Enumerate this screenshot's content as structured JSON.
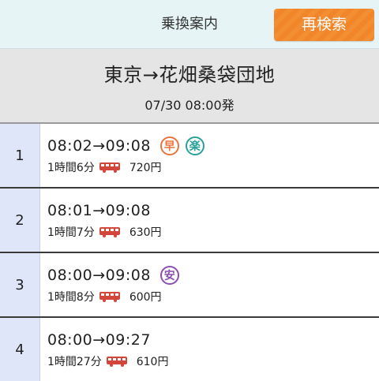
{
  "header": {
    "title": "乗換案内",
    "research_label": "再検索"
  },
  "route": {
    "name": "東京→花畑桑袋団地",
    "datetime": "07/30  08:00発"
  },
  "results": [
    {
      "index": "1",
      "time": "08:02→09:08",
      "duration": "1時間6分",
      "fare": "720円",
      "badges": [
        {
          "label": "早",
          "type": "fast"
        },
        {
          "label": "楽",
          "type": "easy"
        }
      ]
    },
    {
      "index": "2",
      "time": "08:01→09:08",
      "duration": "1時間7分",
      "fare": "630円",
      "badges": []
    },
    {
      "index": "3",
      "time": "08:00→09:08",
      "duration": "1時間8分",
      "fare": "600円",
      "badges": [
        {
          "label": "安",
          "type": "cheap"
        }
      ]
    },
    {
      "index": "4",
      "time": "08:00→09:27",
      "duration": "1時間27分",
      "fare": "610円",
      "badges": []
    }
  ],
  "colors": {
    "header_bg": "#e6f4f6",
    "button_orange": "#f38e33",
    "index_bg": "#dfe6fa",
    "bus_red": "#d2463c"
  },
  "icons": {
    "transport": "bus-icon"
  }
}
